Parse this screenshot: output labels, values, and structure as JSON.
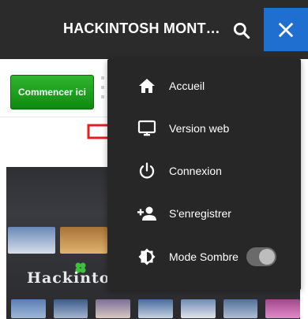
{
  "header": {
    "site_title": "HACKINTOSH MONTRÉ...",
    "search_icon": "search-icon",
    "close_icon": "close-icon",
    "accent_color": "#1f6fd1",
    "background_color": "#2b2b2b"
  },
  "page": {
    "start_button_label": "Commencer ici",
    "brand_text": "Hackintos"
  },
  "menu": {
    "items": [
      {
        "label": "Accueil",
        "icon": "home-icon"
      },
      {
        "label": "Version web",
        "icon": "desktop-icon"
      },
      {
        "label": "Connexion",
        "icon": "power-icon"
      },
      {
        "label": "S'enregistrer",
        "icon": "add-user-icon"
      },
      {
        "label": "Mode Sombre",
        "icon": "brightness-icon",
        "toggle_on": true
      }
    ],
    "background_color": "#272727"
  },
  "annotation": {
    "arrow_color": "#e02020"
  }
}
